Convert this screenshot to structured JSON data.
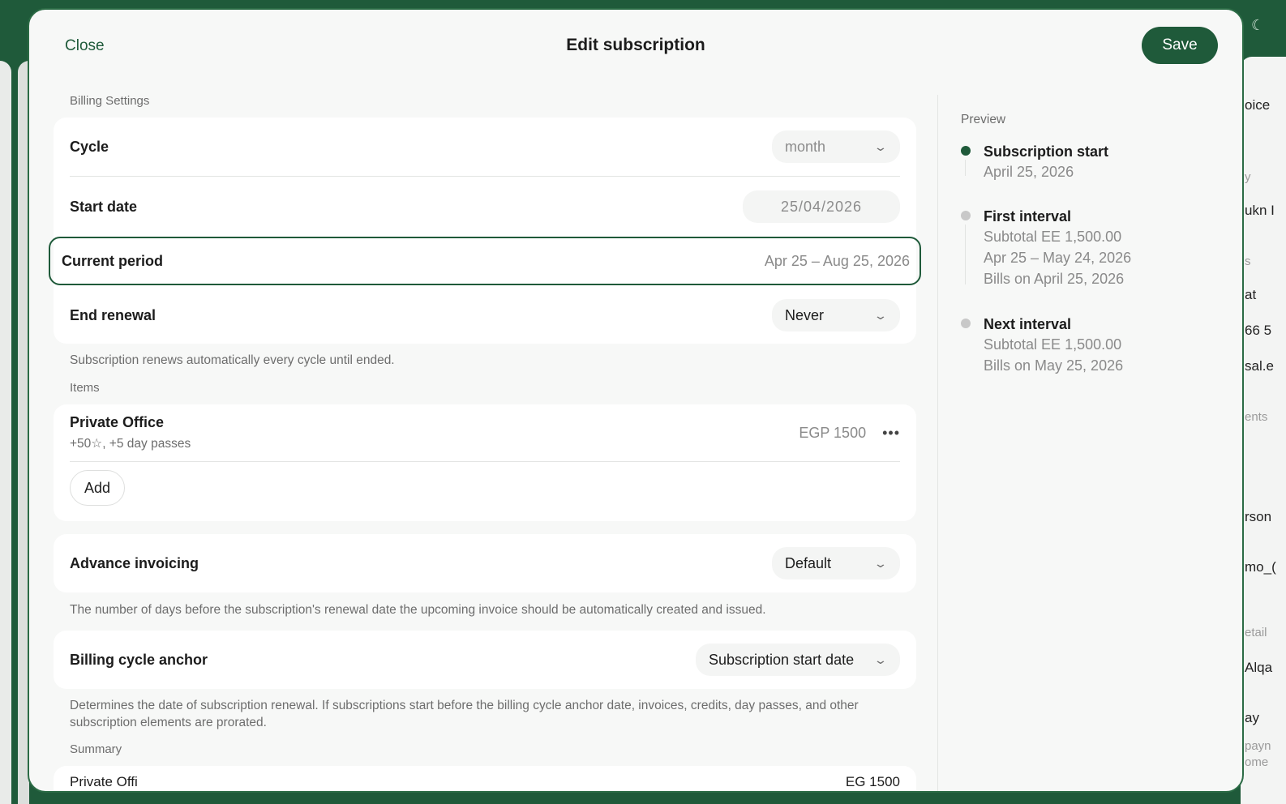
{
  "modal": {
    "close_label": "Close",
    "title": "Edit subscription",
    "save_label": "Save"
  },
  "billing": {
    "section_label": "Billing Settings",
    "cycle_label": "Cycle",
    "cycle_value": "month",
    "start_date_label": "Start date",
    "start_date_value": "25/04/2026",
    "current_period_label": "Current period",
    "current_period_value": "Apr 25 – Aug 25, 2026",
    "end_renewal_label": "End renewal",
    "end_renewal_value": "Never",
    "help": "Subscription renews automatically every cycle until ended."
  },
  "items": {
    "section_label": "Items",
    "list": [
      {
        "name": "Private Office",
        "meta": "+50☆, +5 day passes",
        "price": "EGP 1500"
      }
    ],
    "add_label": "Add"
  },
  "advance": {
    "label": "Advance invoicing",
    "value": "Default",
    "help": "The number of days before the subscription's renewal date the upcoming invoice should be automatically created and issued."
  },
  "anchor": {
    "label": "Billing cycle anchor",
    "value": "Subscription start date",
    "help": "Determines the date of subscription renewal. If subscriptions start before the billing cycle anchor date, invoices, credits, day passes, and other subscription elements are prorated."
  },
  "summary": {
    "section_label": "Summary",
    "first_item_partial": "Private Offi",
    "first_price_partial": "EG 1500"
  },
  "preview": {
    "label": "Preview",
    "steps": [
      {
        "title": "Subscription start",
        "lines": [
          "April 25, 2026"
        ]
      },
      {
        "title": "First interval",
        "lines": [
          "Subtotal EE 1,500.00",
          "Apr 25 – May 24, 2026",
          "Bills on April 25, 2026"
        ]
      },
      {
        "title": "Next interval",
        "lines": [
          "Subtotal EE 1,500.00",
          "Bills on May 25, 2026"
        ]
      }
    ]
  },
  "background": {
    "fragments": [
      "oice",
      "y",
      "ukn I",
      "s",
      "at",
      "66 5",
      "sal.e",
      "ents",
      "rson",
      "mo_(",
      "etail",
      "Alqa",
      "ay",
      "payn",
      "ome"
    ]
  },
  "colors": {
    "brand": "#1f5a3a",
    "modal_bg": "#f7f8f7",
    "card_bg": "#ffffff"
  }
}
